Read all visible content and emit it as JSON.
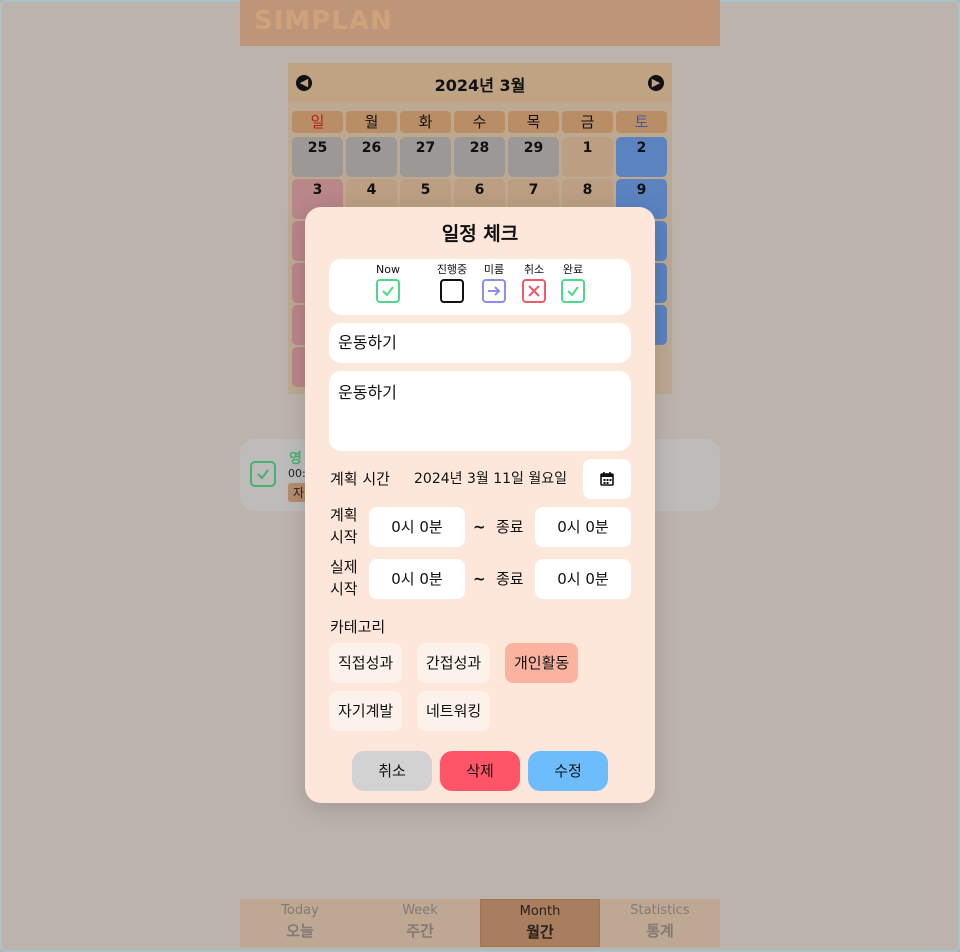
{
  "app": {
    "logo": "SIMPLAN"
  },
  "calendar": {
    "title": "2024년 3월",
    "weekdays": [
      "일",
      "월",
      "화",
      "수",
      "목",
      "금",
      "토"
    ],
    "row1": [
      "25",
      "26",
      "27",
      "28",
      "29",
      "1",
      "2"
    ],
    "row2": [
      "3",
      "4",
      "5",
      "6",
      "7",
      "8",
      "9"
    ]
  },
  "todo_card": {
    "title_partial": "영",
    "time_partial": "00:",
    "tag_partial": "자"
  },
  "tabs": [
    {
      "en": "Today",
      "ko": "오늘"
    },
    {
      "en": "Week",
      "ko": "주간"
    },
    {
      "en": "Month",
      "ko": "월간"
    },
    {
      "en": "Statistics",
      "ko": "통계"
    }
  ],
  "modal": {
    "title": "일정 체크",
    "statuses": [
      {
        "label": "Now",
        "icon": "check-icon",
        "color": "#4cd98a"
      },
      {
        "label": "진행중",
        "icon": "empty-box-icon",
        "color": "#111111"
      },
      {
        "label": "미룸",
        "icon": "arrow-right-icon",
        "color": "#8a8ff0"
      },
      {
        "label": "취소",
        "icon": "x-icon",
        "color": "#ef5b6b"
      },
      {
        "label": "완료",
        "icon": "check-icon",
        "color": "#4cd98a"
      }
    ],
    "title_value": "운동하기",
    "memo_value": "운동하기",
    "plan_time_label": "계획 시간",
    "plan_date": "2024년 3월 11일 월요일",
    "plan_start_label": "계획\n시작",
    "plan_start": "0시 0분",
    "plan_end_label": "종료",
    "plan_end": "0시 0분",
    "actual_start_label": "실제\n시작",
    "actual_start": "0시 0분",
    "actual_end_label": "종료",
    "actual_end": "0시 0분",
    "tilde": "~",
    "category_label": "카테고리",
    "categories": [
      "직접성과",
      "간접성과",
      "개인활동",
      "자기계발",
      "네트워킹"
    ],
    "selected_category": "개인활동",
    "buttons": {
      "cancel": "취소",
      "delete": "삭제",
      "edit": "수정"
    },
    "colors": {
      "cancel": "#d2d2d2",
      "delete": "#ff5566",
      "edit": "#6dbdfc"
    }
  }
}
